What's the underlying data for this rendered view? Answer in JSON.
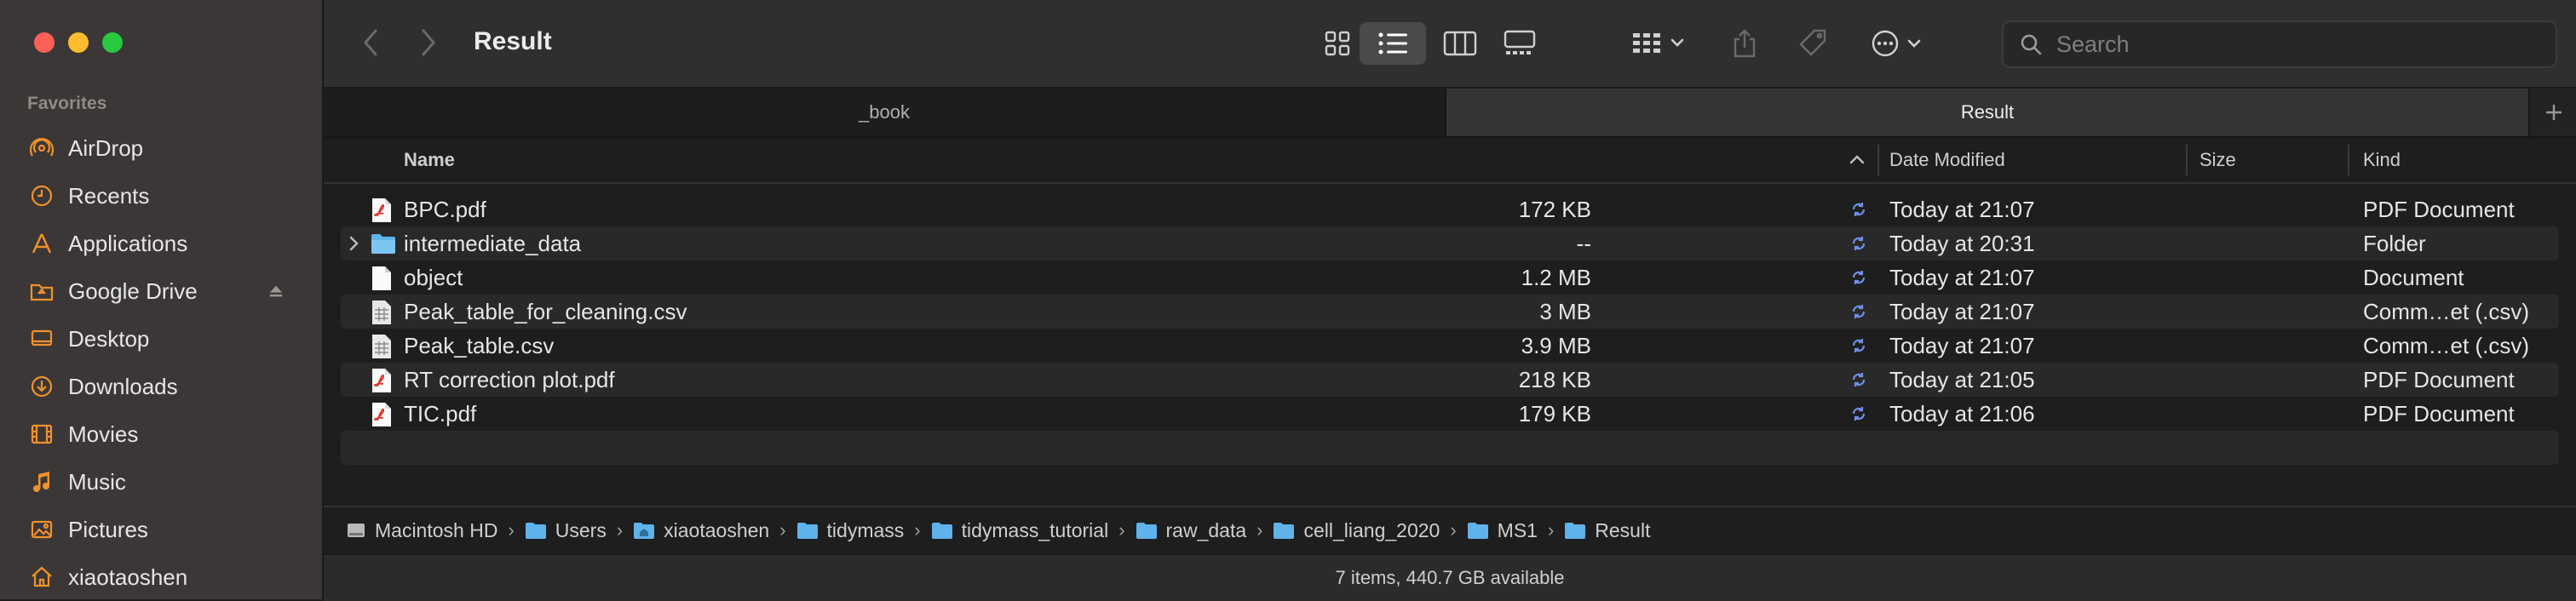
{
  "window": {
    "title": "Result"
  },
  "sidebar": {
    "heading": "Favorites",
    "items": [
      {
        "label": "AirDrop",
        "icon": "airdrop-icon"
      },
      {
        "label": "Recents",
        "icon": "clock-icon"
      },
      {
        "label": "Applications",
        "icon": "applications-icon"
      },
      {
        "label": "Google Drive",
        "icon": "drive-folder-icon"
      },
      {
        "label": "Desktop",
        "icon": "desktop-icon"
      },
      {
        "label": "Downloads",
        "icon": "downloads-icon"
      },
      {
        "label": "Movies",
        "icon": "film-icon"
      },
      {
        "label": "Music",
        "icon": "music-note-icon"
      },
      {
        "label": "Pictures",
        "icon": "picture-icon"
      },
      {
        "label": "xiaotaoshen",
        "icon": "home-icon"
      }
    ]
  },
  "toolbar": {
    "search_placeholder": "Search"
  },
  "tabs": [
    {
      "label": "_book"
    },
    {
      "label": "Result"
    }
  ],
  "columns": {
    "name": "Name",
    "date": "Date Modified",
    "size": "Size",
    "kind": "Kind"
  },
  "files": [
    {
      "name": "BPC.pdf",
      "date": "Today at 21:07",
      "size": "172 KB",
      "kind": "PDF Document",
      "type": "pdf"
    },
    {
      "name": "intermediate_data",
      "date": "Today at 20:31",
      "size": "--",
      "kind": "Folder",
      "type": "folder"
    },
    {
      "name": "object",
      "date": "Today at 21:07",
      "size": "1.2 MB",
      "kind": "Document",
      "type": "doc"
    },
    {
      "name": "Peak_table_for_cleaning.csv",
      "date": "Today at 21:07",
      "size": "3 MB",
      "kind": "Comm…et (.csv)",
      "type": "csv"
    },
    {
      "name": "Peak_table.csv",
      "date": "Today at 21:07",
      "size": "3.9 MB",
      "kind": "Comm…et (.csv)",
      "type": "csv"
    },
    {
      "name": "RT correction plot.pdf",
      "date": "Today at 21:05",
      "size": "218 KB",
      "kind": "PDF Document",
      "type": "pdf"
    },
    {
      "name": "TIC.pdf",
      "date": "Today at 21:06",
      "size": "179 KB",
      "kind": "PDF Document",
      "type": "pdf"
    }
  ],
  "path": [
    "Macintosh HD",
    "Users",
    "xiaotaoshen",
    "tidymass",
    "tidymass_tutorial",
    "raw_data",
    "cell_liang_2020",
    "MS1",
    "Result"
  ],
  "status": "7 items, 440.7 GB available",
  "colors": {
    "accent": "#f0922b",
    "folder": "#5fb2ea",
    "sync": "#6d8fe6"
  }
}
